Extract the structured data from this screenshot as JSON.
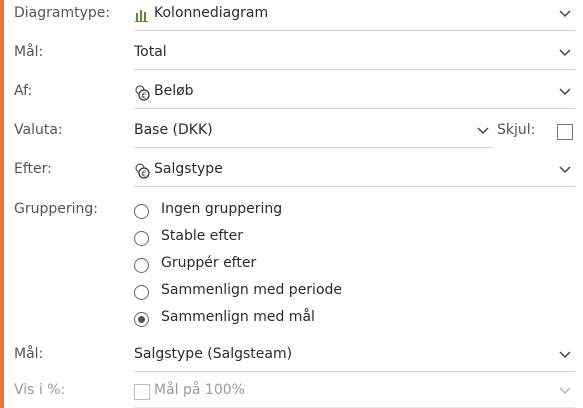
{
  "colors": {
    "accent": "#e8733a",
    "chart_icon": "#5a8f2e"
  },
  "fields": {
    "diagramtype": {
      "label": "Diagramtype:",
      "value": "Kolonnediagram",
      "icon": "bar-chart-icon"
    },
    "maal": {
      "label": "Mål:",
      "value": "Total"
    },
    "af": {
      "label": "Af:",
      "value": "Beløb",
      "icon": "money-icon"
    },
    "valuta": {
      "label": "Valuta:",
      "value": "Base (DKK)",
      "skjul_label": "Skjul:"
    },
    "efter": {
      "label": "Efter:",
      "value": "Salgstype",
      "icon": "money-icon"
    },
    "gruppering": {
      "label": "Gruppering:",
      "options": [
        "Ingen gruppering",
        "Stable efter",
        "Gruppér efter",
        "Sammenlign med periode",
        "Sammenlign med mål"
      ],
      "selected": "Sammenlign med mål"
    },
    "maal2": {
      "label": "Mål:",
      "value": "Salgstype (Salgsteam)"
    },
    "vis_procent": {
      "label": "Vis i %:",
      "checkbox_label": "Mål på 100%"
    }
  }
}
